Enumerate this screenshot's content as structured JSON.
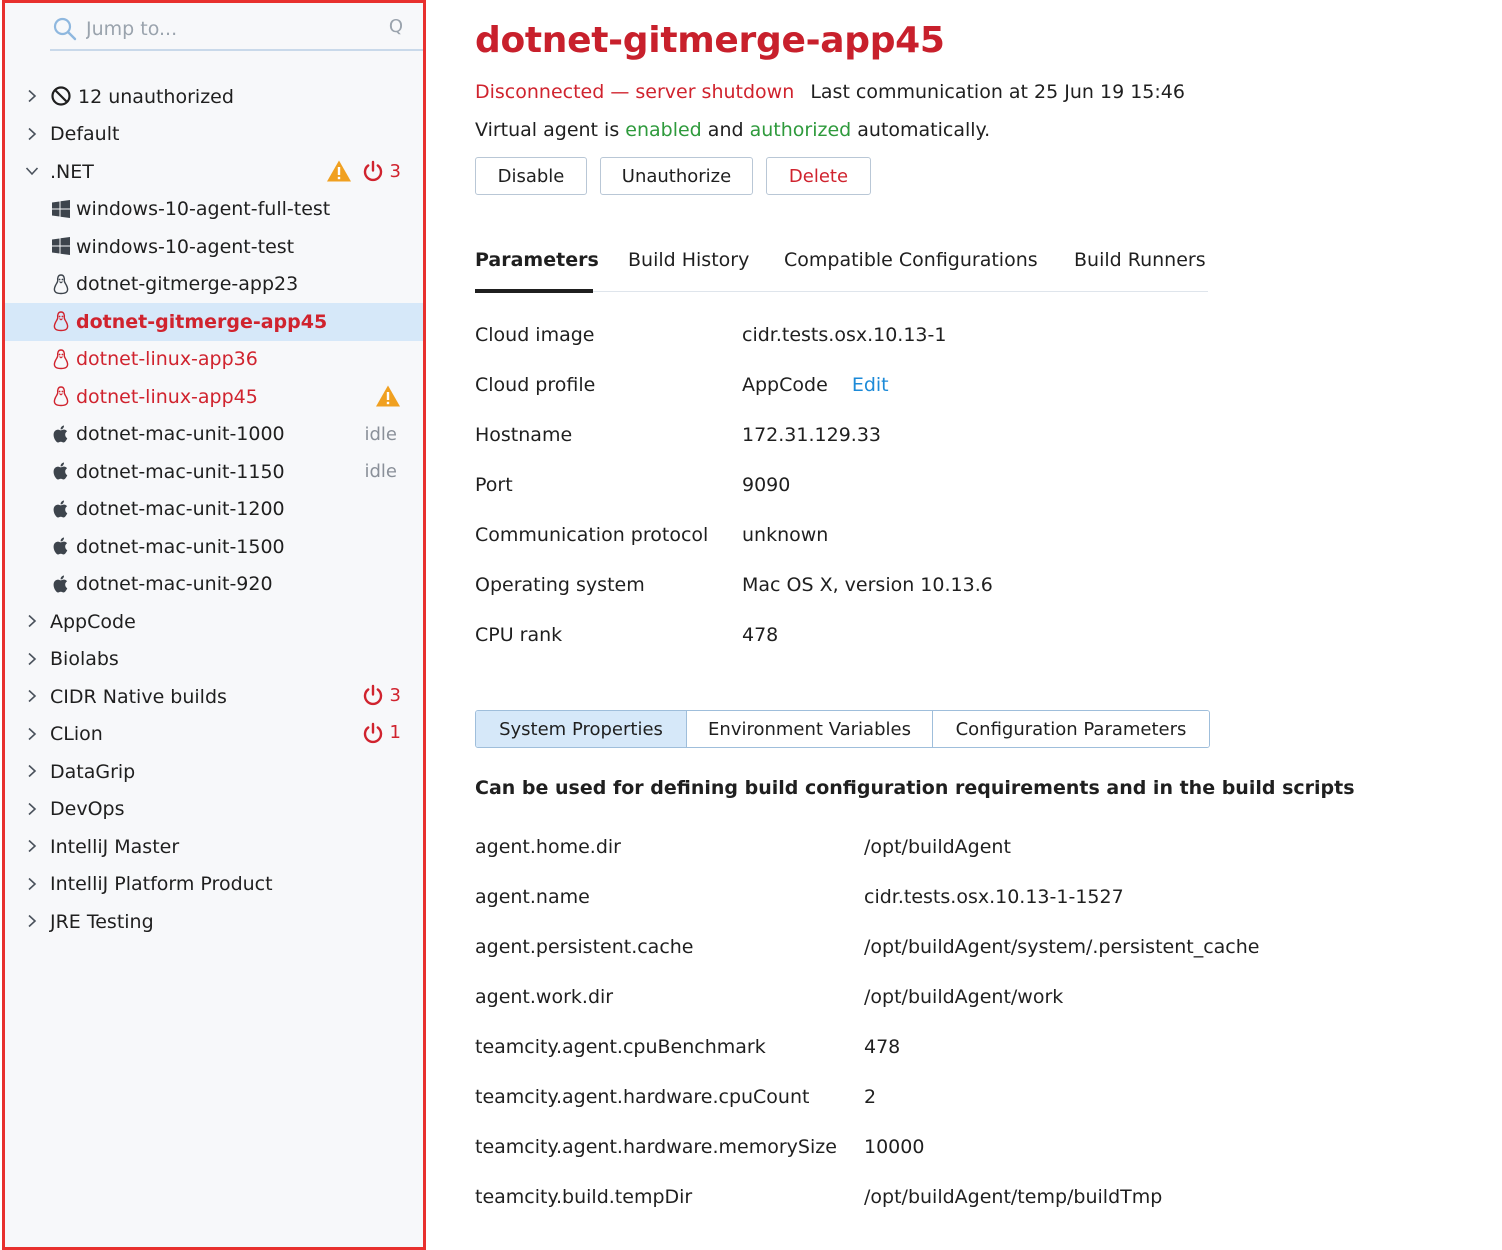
{
  "search": {
    "placeholder": "Jump to...",
    "shortcut": "Q"
  },
  "sidebar": {
    "unauthorized": "12 unauthorized",
    "pools": [
      {
        "label": "Default"
      },
      {
        "label": ".NET",
        "warning": true,
        "offline_count": "3"
      },
      {
        "label": "AppCode"
      },
      {
        "label": "Biolabs"
      },
      {
        "label": "CIDR Native builds",
        "offline_count": "3"
      },
      {
        "label": "CLion",
        "offline_count": "1"
      },
      {
        "label": "DataGrip"
      },
      {
        "label": "DevOps"
      },
      {
        "label": "IntelliJ Master"
      },
      {
        "label": "IntelliJ Platform Product"
      },
      {
        "label": "JRE Testing"
      }
    ],
    "agents": [
      {
        "label": "windows-10-agent-full-test",
        "os": "windows"
      },
      {
        "label": "windows-10-agent-test",
        "os": "windows"
      },
      {
        "label": "dotnet-gitmerge-app23",
        "os": "linux"
      },
      {
        "label": "dotnet-gitmerge-app45",
        "os": "linux",
        "state": "disconnected",
        "selected": true
      },
      {
        "label": "dotnet-linux-app36",
        "os": "linux",
        "state": "disconnected"
      },
      {
        "label": "dotnet-linux-app45",
        "os": "linux",
        "state": "disconnected",
        "warning": true
      },
      {
        "label": "dotnet-mac-unit-1000",
        "os": "mac",
        "status": "idle"
      },
      {
        "label": "dotnet-mac-unit-1150",
        "os": "mac",
        "status": "idle"
      },
      {
        "label": "dotnet-mac-unit-1200",
        "os": "mac"
      },
      {
        "label": "dotnet-mac-unit-1500",
        "os": "mac"
      },
      {
        "label": "dotnet-mac-unit-920",
        "os": "mac"
      }
    ]
  },
  "agent": {
    "title": "dotnet-gitmerge-app45",
    "status": "Disconnected — server shutdown",
    "last_comm": "Last communication at 25 Jun 19 15:46",
    "virtual_prefix": "Virtual agent is",
    "enabled": "enabled",
    "and": "and",
    "authorized": "authorized",
    "virtual_suffix": "automatically.",
    "buttons": {
      "disable": "Disable",
      "unauthorize": "Unauthorize",
      "delete": "Delete"
    }
  },
  "tabs": [
    "Parameters",
    "Build History",
    "Compatible Configurations",
    "Build Runners"
  ],
  "parameters": [
    {
      "key": "Cloud image",
      "value": "cidr.tests.osx.10.13-1"
    },
    {
      "key": "Cloud profile",
      "value": "AppCode",
      "link": "Edit"
    },
    {
      "key": "Hostname",
      "value": "172.31.129.33"
    },
    {
      "key": "Port",
      "value": "9090"
    },
    {
      "key": "Communication protocol",
      "value": "unknown"
    },
    {
      "key": "Operating system",
      "value": "Mac OS X, version 10.13.6"
    },
    {
      "key": "CPU rank",
      "value": "478"
    }
  ],
  "property_tabs": [
    "System Properties",
    "Environment Variables",
    "Configuration Parameters"
  ],
  "property_description": "Can be used for defining build configuration requirements and in the build scripts",
  "system_properties": [
    {
      "key": "agent.home.dir",
      "value": "/opt/buildAgent"
    },
    {
      "key": "agent.name",
      "value": "cidr.tests.osx.10.13-1-1527"
    },
    {
      "key": "agent.persistent.cache",
      "value": "/opt/buildAgent/system/.persistent_cache"
    },
    {
      "key": "agent.work.dir",
      "value": "/opt/buildAgent/work"
    },
    {
      "key": "teamcity.agent.cpuBenchmark",
      "value": "478"
    },
    {
      "key": "teamcity.agent.hardware.cpuCount",
      "value": "2"
    },
    {
      "key": "teamcity.agent.hardware.memorySize",
      "value": "10000"
    },
    {
      "key": "teamcity.build.tempDir",
      "value": "/opt/buildAgent/temp/buildTmp"
    }
  ],
  "colors": {
    "accent_red": "#d0232e",
    "green": "#2e9a3c",
    "link": "#1c8ad8",
    "selected_bg": "#d6e8f9",
    "warning": "#f0a020"
  }
}
